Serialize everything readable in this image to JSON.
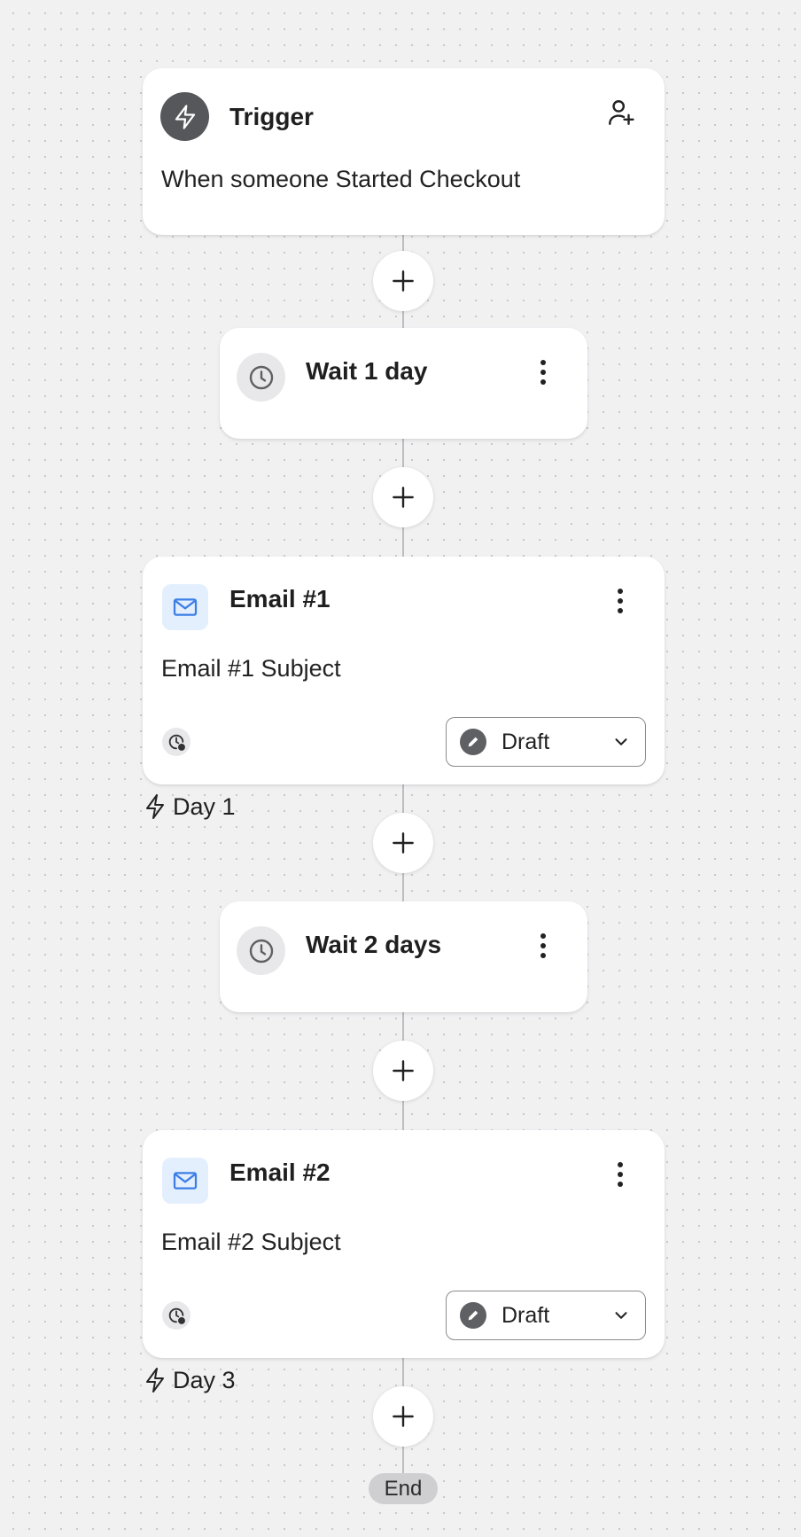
{
  "trigger": {
    "title": "Trigger",
    "description": "When someone Started Checkout",
    "icon": "lightning-icon",
    "action_icon": "user-plus-icon"
  },
  "wait1": {
    "title": "Wait 1 day",
    "icon": "clock-icon"
  },
  "email1": {
    "title": "Email #1",
    "subject": "Email #1 Subject",
    "status": "Draft",
    "day_label": "Day 1"
  },
  "wait2": {
    "title": "Wait 2 days",
    "icon": "clock-icon"
  },
  "email2": {
    "title": "Email #2",
    "subject": "Email #2 Subject",
    "status": "Draft",
    "day_label": "Day 3"
  },
  "end_label": "End",
  "colors": {
    "background": "#f1f1f2",
    "card": "#ffffff",
    "mail_icon_bg": "#e4effe",
    "mail_icon": "#3d7ee6",
    "connector": "#bdbdc0",
    "end_pill": "#cfcfd2"
  }
}
